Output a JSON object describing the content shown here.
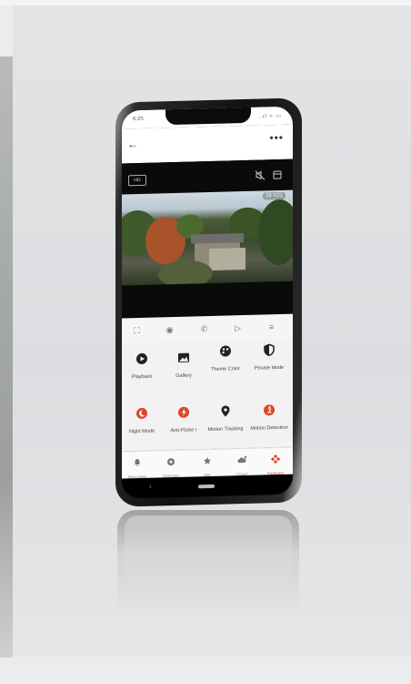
{
  "status_bar": {
    "time": "6:25",
    "icons": "..ıl ≈ ▭"
  },
  "header": {
    "back_icon": "←",
    "more_icon": "•••"
  },
  "video": {
    "quality_label": "HD",
    "timestamp": "29 X21"
  },
  "controls": [
    {
      "name": "fullscreen-icon",
      "glyph": "⛶"
    },
    {
      "name": "screenshot-icon",
      "glyph": "◉"
    },
    {
      "name": "call-icon",
      "glyph": "✆"
    },
    {
      "name": "record-icon",
      "glyph": "▷"
    },
    {
      "name": "expand-icon",
      "glyph": "≡"
    }
  ],
  "features": [
    {
      "label": "Playback",
      "icon": "play-circle-icon",
      "color": "#222222"
    },
    {
      "label": "Gallery",
      "icon": "image-icon",
      "color": "#222222"
    },
    {
      "label": "Theme Color",
      "icon": "palette-icon",
      "color": "#222222"
    },
    {
      "label": "Private Mode",
      "icon": "private-mode-icon",
      "color": "#222222"
    },
    {
      "label": "Night Mode",
      "icon": "night-mode-icon",
      "color": "#e0442a"
    },
    {
      "label": "Anti-Flicke r",
      "icon": "anti-flicker-icon",
      "color": "#e0442a"
    },
    {
      "label": "Motion Tracking",
      "icon": "location-pin-icon",
      "color": "#222222"
    },
    {
      "label": "Motion Detection",
      "icon": "motion-detection-icon",
      "color": "#e0442a"
    }
  ],
  "nav": [
    {
      "label": "Messages",
      "icon": "bell-icon"
    },
    {
      "label": "Direction",
      "icon": "direction-icon"
    },
    {
      "label": "Site",
      "icon": "star-icon"
    },
    {
      "label": "Cloud",
      "icon": "cloud-icon"
    },
    {
      "label": "Features",
      "icon": "features-icon"
    }
  ],
  "colors": {
    "accent": "#e0442a"
  }
}
